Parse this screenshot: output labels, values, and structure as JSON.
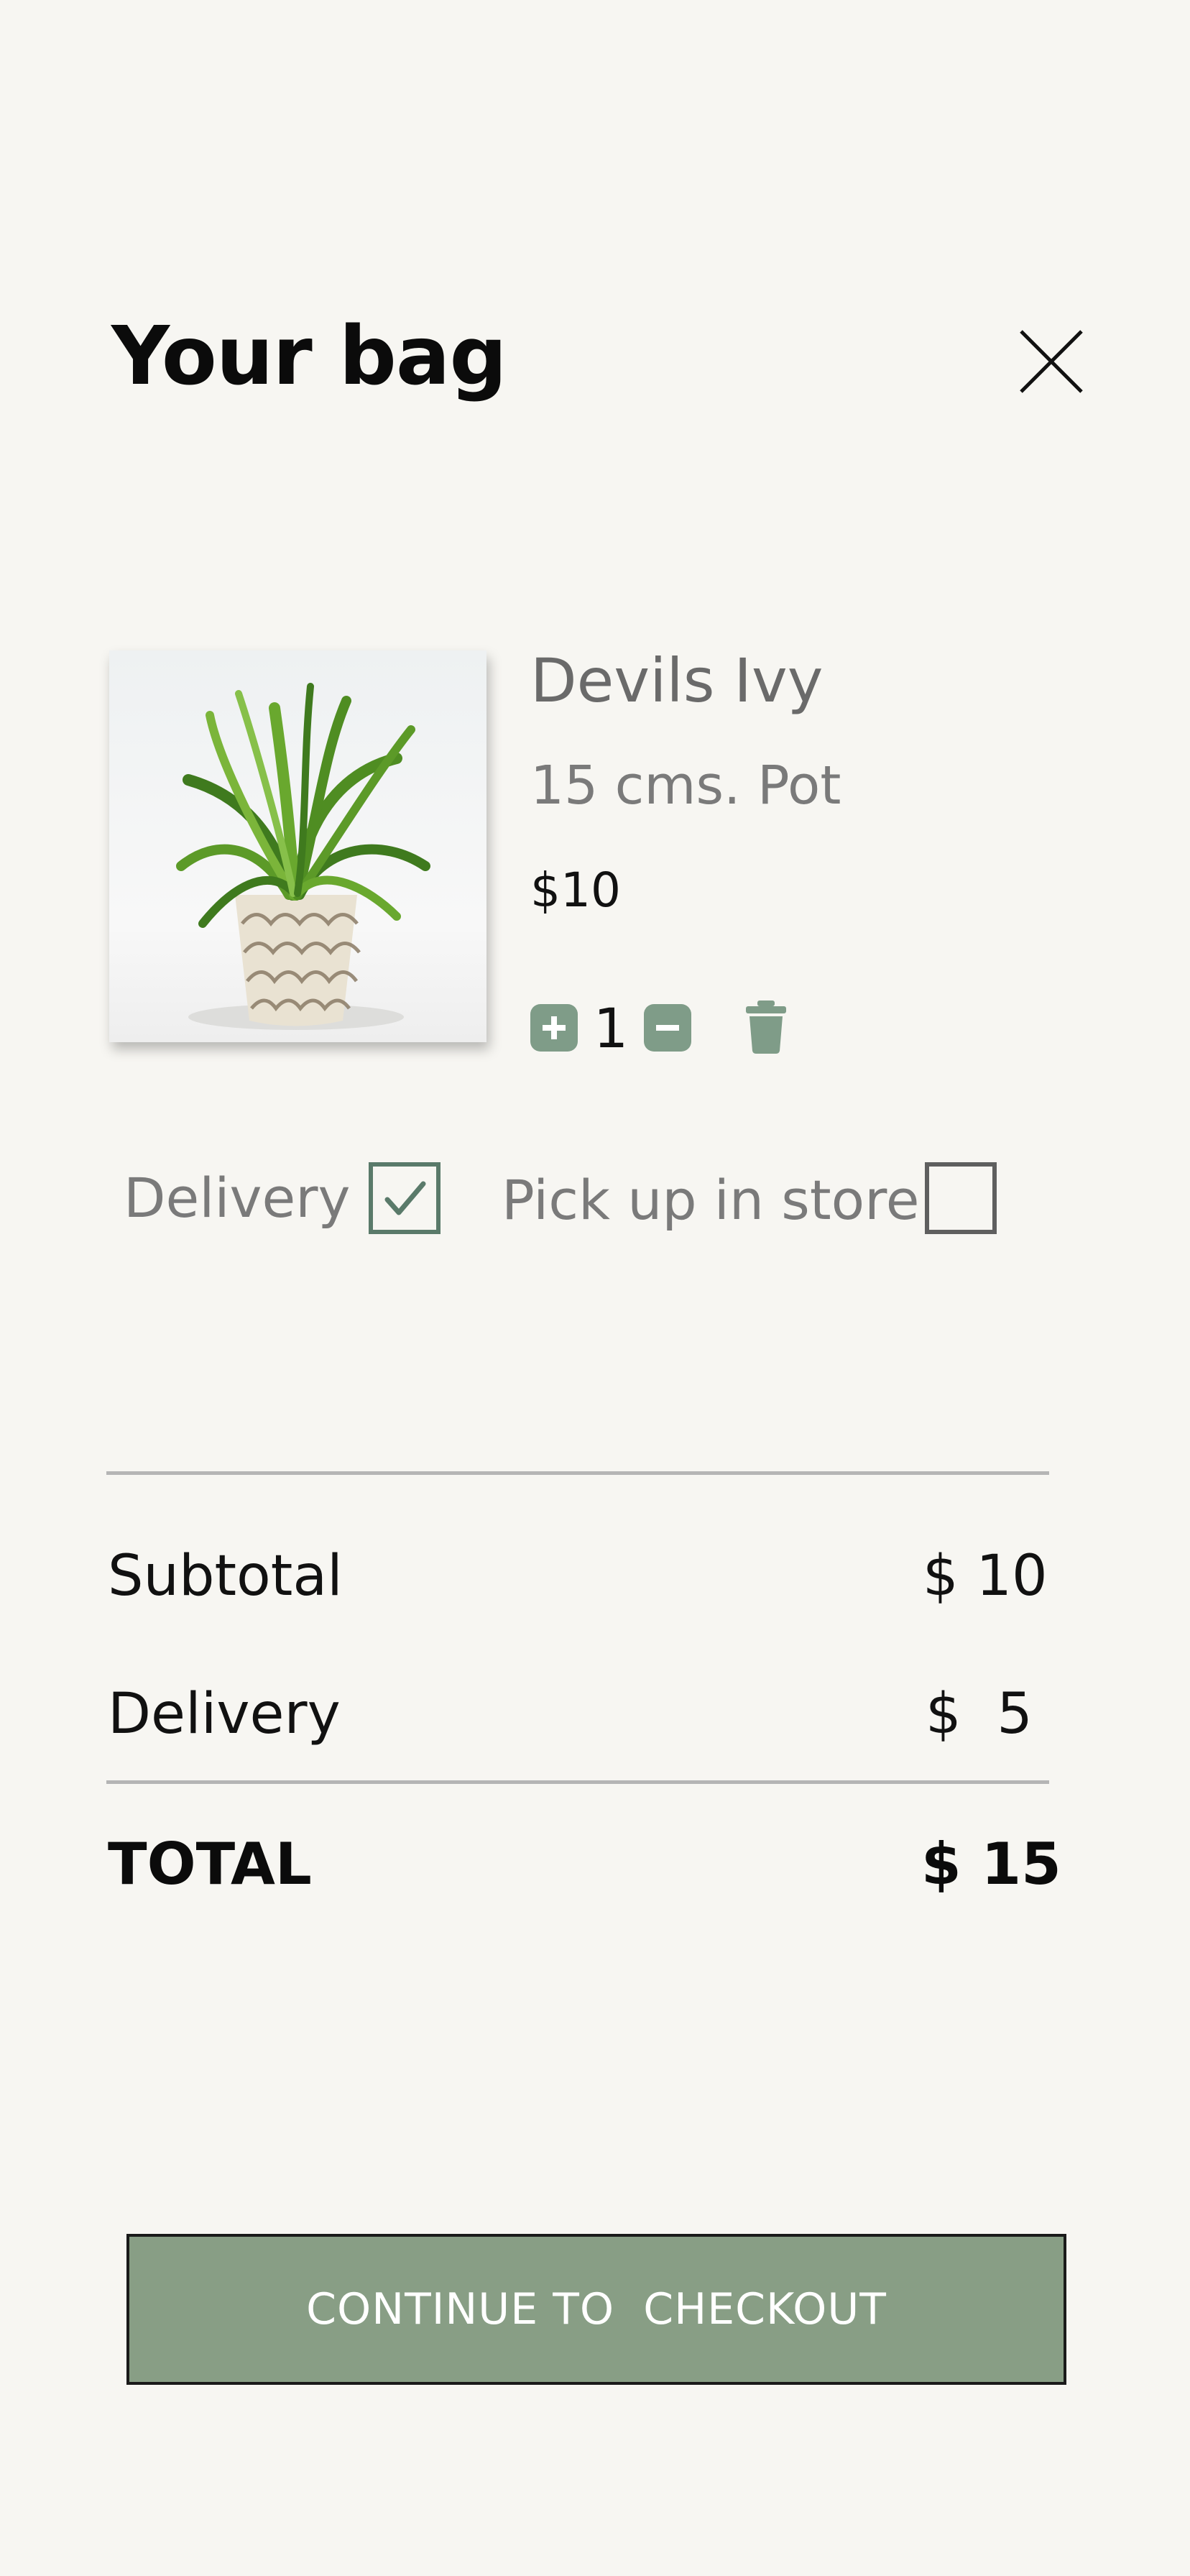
{
  "header": {
    "title": "Your bag",
    "close_icon": "close-icon"
  },
  "cart_item": {
    "name": "Devils Ivy",
    "variant": "15 cms. Pot",
    "price": "$10",
    "quantity": "1",
    "increment_icon": "plus-icon",
    "decrement_icon": "minus-icon",
    "remove_icon": "trash-icon",
    "image_icon": "potted-plant-image"
  },
  "fulfillment": {
    "delivery_label": "Delivery",
    "delivery_checked": true,
    "pickup_label": "Pick up in store",
    "pickup_checked": false
  },
  "summary": {
    "subtotal_label": "Subtotal",
    "subtotal_value": "$ 10",
    "delivery_label": "Delivery",
    "delivery_value": "$  5",
    "total_label": "TOTAL",
    "total_value": "$ 15"
  },
  "checkout": {
    "label": "CONTINUE TO  CHECKOUT"
  },
  "colors": {
    "background": "#f7f6f2",
    "accent_green": "#889e85",
    "icon_green": "#7f9c88",
    "checkbox_green": "#5a7a6a"
  }
}
